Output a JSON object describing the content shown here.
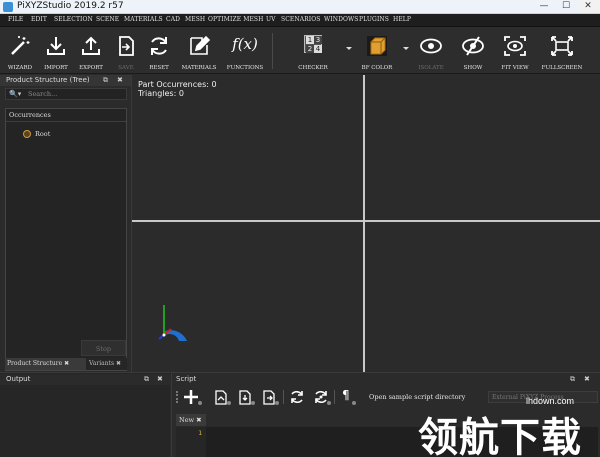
{
  "window": {
    "title": "PiXYZStudio 2019.2 r57",
    "minimize": "—",
    "maximize": "☐",
    "close": "✕"
  },
  "menu": [
    "FILE",
    "EDIT",
    "SELECTION",
    "SCENE",
    "MATERIALS",
    "CAD",
    "MESH",
    "OPTIMIZE MESH",
    "UV",
    "SCENARIOS",
    "WINDOWS",
    "PLUGINS",
    "HELP"
  ],
  "toolbar": {
    "wizard": "WIZARD",
    "import": "IMPORT",
    "export": "EXPORT",
    "save": "SAVE",
    "reset": "RESET",
    "materials": "MATERIALS",
    "functions": "FUNCTIONS",
    "functions_glyph": "f(x)",
    "checker": "CHECKER",
    "checker_digits": [
      "1",
      "3",
      "2",
      "4"
    ],
    "bf_color": "BF COLOR",
    "isolate": "ISOLATE",
    "show": "SHOW",
    "fit_view": "FIT VIEW",
    "fullscreen": "FULLSCREEN"
  },
  "tree_panel": {
    "title": "Product Structure (Tree)",
    "float_glyph": "⧉",
    "close_glyph": "✖",
    "search_icon": "🔍▾",
    "search_placeholder": "Search...",
    "column_header": "Occurrences",
    "root_label": "Root",
    "stop_label": "Stop",
    "tabs": [
      "Product Structure ✖",
      "Variants ✖"
    ]
  },
  "viewport": {
    "part_occurrences": "Part Occurrences: 0",
    "triangles": "Triangles: 0"
  },
  "output_panel": {
    "title": "Output",
    "float_glyph": "⧉",
    "close_glyph": "✖"
  },
  "script_panel": {
    "title": "Script",
    "float_glyph": "⧉",
    "close_glyph": "✖",
    "open_dir_label": "Open sample script directory",
    "external_label": "External PiXYZ Process",
    "tab_label": "New ✖",
    "line_number": "1"
  },
  "watermark": {
    "site": "lhdown.com",
    "text": "领航下载"
  },
  "colors": {
    "accent": "#1f6fd0",
    "axis_x": "#d02020",
    "axis_y": "#20a020",
    "axis_z": "#2040d0",
    "bf_cube": "#e0a030"
  }
}
